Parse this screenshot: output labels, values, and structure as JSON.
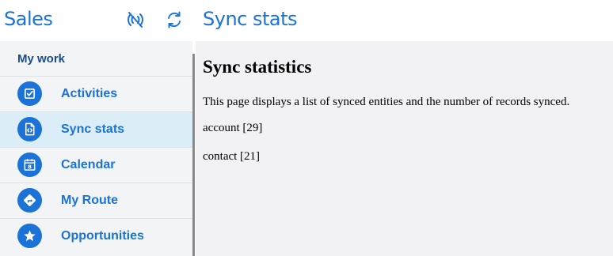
{
  "app": {
    "title": "Sales"
  },
  "header": {
    "page_title": "Sync stats",
    "icons": [
      "offline-sync-icon",
      "refresh-icon"
    ]
  },
  "sidebar": {
    "group_label": "My work",
    "items": [
      {
        "label": "Activities",
        "icon": "activities-icon",
        "active": false
      },
      {
        "label": "Sync stats",
        "icon": "sync-stats-icon",
        "active": true
      },
      {
        "label": "Calendar",
        "icon": "calendar-icon",
        "active": false
      },
      {
        "label": "My Route",
        "icon": "route-icon",
        "active": false
      },
      {
        "label": "Opportunities",
        "icon": "star-icon",
        "active": false
      }
    ]
  },
  "main": {
    "heading": "Sync statistics",
    "description": "This page displays a list of synced entities and the number of records synced.",
    "entities": [
      "account [29]",
      "contact [21]"
    ]
  },
  "colors": {
    "accent": "#1b73d8",
    "active_bg": "#dbeef8",
    "sidebar_bg": "#f3f4f6",
    "content_bg": "#f2f2f4"
  }
}
